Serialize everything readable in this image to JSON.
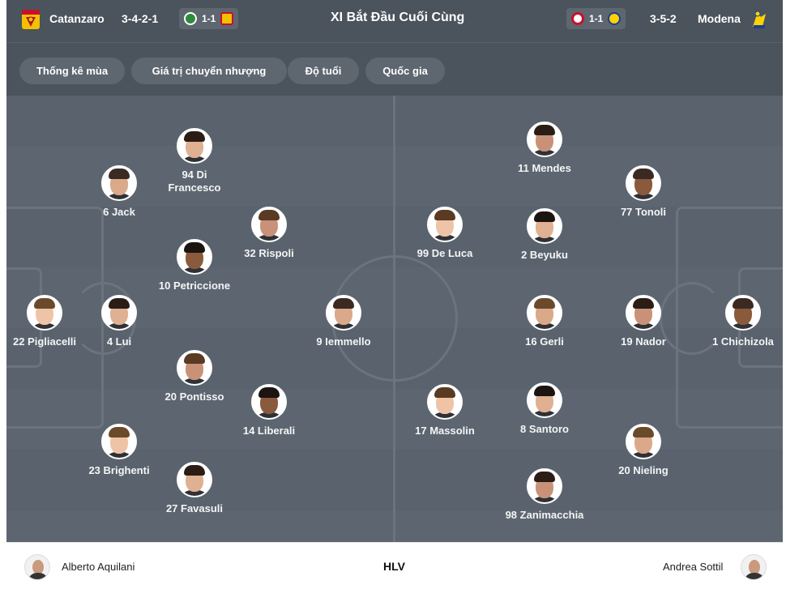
{
  "header": {
    "title": "XI Bắt Đầu Cuối Cùng",
    "home": {
      "name": "Catanzaro",
      "formation": "3-4-2-1",
      "form_score": "1-1"
    },
    "away": {
      "name": "Modena",
      "formation": "3-5-2",
      "form_score": "1-1"
    }
  },
  "filters": [
    "Thống kê mùa",
    "Giá trị chuyển nhượng",
    "Độ tuổi",
    "Quốc gia"
  ],
  "home_players": [
    {
      "label": "94 Di Francesco"
    },
    {
      "label": "6 Jack"
    },
    {
      "label": "32 Rispoli"
    },
    {
      "label": "10 Petriccione"
    },
    {
      "label": "22 Pigliacelli"
    },
    {
      "label": "4 Lui"
    },
    {
      "label": "9 Iemmello"
    },
    {
      "label": "20 Pontisso"
    },
    {
      "label": "14 Liberali"
    },
    {
      "label": "23 Brighenti"
    },
    {
      "label": "27 Favasuli"
    }
  ],
  "away_players": [
    {
      "label": "11 Mendes"
    },
    {
      "label": "77 Tonoli"
    },
    {
      "label": "99 De Luca"
    },
    {
      "label": "2 Beyuku"
    },
    {
      "label": "16 Gerli"
    },
    {
      "label": "19 Nador"
    },
    {
      "label": "1 Chichizola"
    },
    {
      "label": "17 Massolin"
    },
    {
      "label": "8 Santoro"
    },
    {
      "label": "20 Nieling"
    },
    {
      "label": "98 Zanimacchia"
    }
  ],
  "footer": {
    "home_coach": "Alberto Aquilani",
    "label": "HLV",
    "away_coach": "Andrea Sottil"
  }
}
